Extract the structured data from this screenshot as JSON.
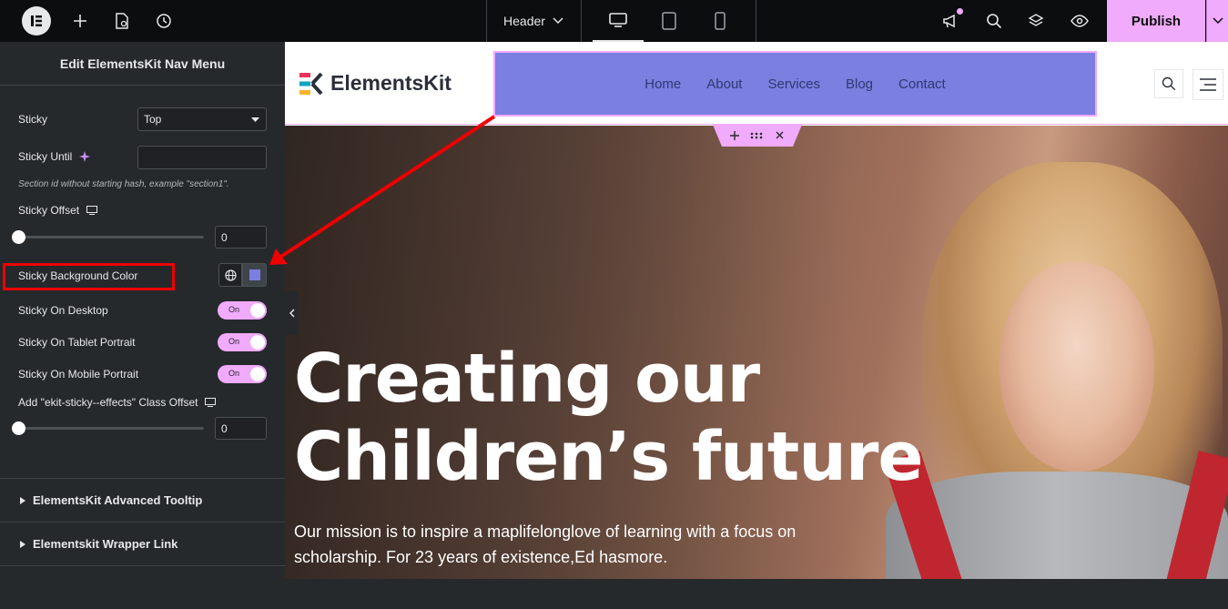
{
  "topbar": {
    "header_select": "Header",
    "publish_label": "Publish"
  },
  "panel": {
    "title": "Edit ElementsKit Nav Menu",
    "sticky": {
      "label": "Sticky",
      "value": "Top"
    },
    "sticky_until": {
      "label": "Sticky Until",
      "value": "",
      "help": "Section id without starting hash, example \"section1\"."
    },
    "sticky_offset": {
      "label": "Sticky Offset",
      "value": "0",
      "level": 0
    },
    "sticky_bg": {
      "label": "Sticky Background Color",
      "color": "#7b7fe0"
    },
    "sticky_desktop": {
      "label": "Sticky On Desktop",
      "state": "On"
    },
    "sticky_tablet": {
      "label": "Sticky On Tablet Portrait",
      "state": "On"
    },
    "sticky_mobile": {
      "label": "Sticky On Mobile Portrait",
      "state": "On"
    },
    "class_offset": {
      "label": "Add \"ekit-sticky--effects\" Class Offset",
      "value": "0",
      "level": 0
    },
    "sections": [
      "ElementsKit Advanced Tooltip",
      "Elementskit Wrapper Link"
    ]
  },
  "site": {
    "logo_text": "ElementsKit",
    "nav": [
      "Home",
      "About",
      "Services",
      "Blog",
      "Contact"
    ],
    "hero_title_1": "Creating our",
    "hero_title_2": "Children’s future",
    "hero_text": "Our mission is to inspire a maplifelonglove of learning with a focus on scholarship. For 23 years of existence,Ed hasmore."
  },
  "colors": {
    "accent": "#f0abfc",
    "nav_bg": "#7b7fe0",
    "panel_bg": "#26292c",
    "annotation": "#e00000"
  }
}
